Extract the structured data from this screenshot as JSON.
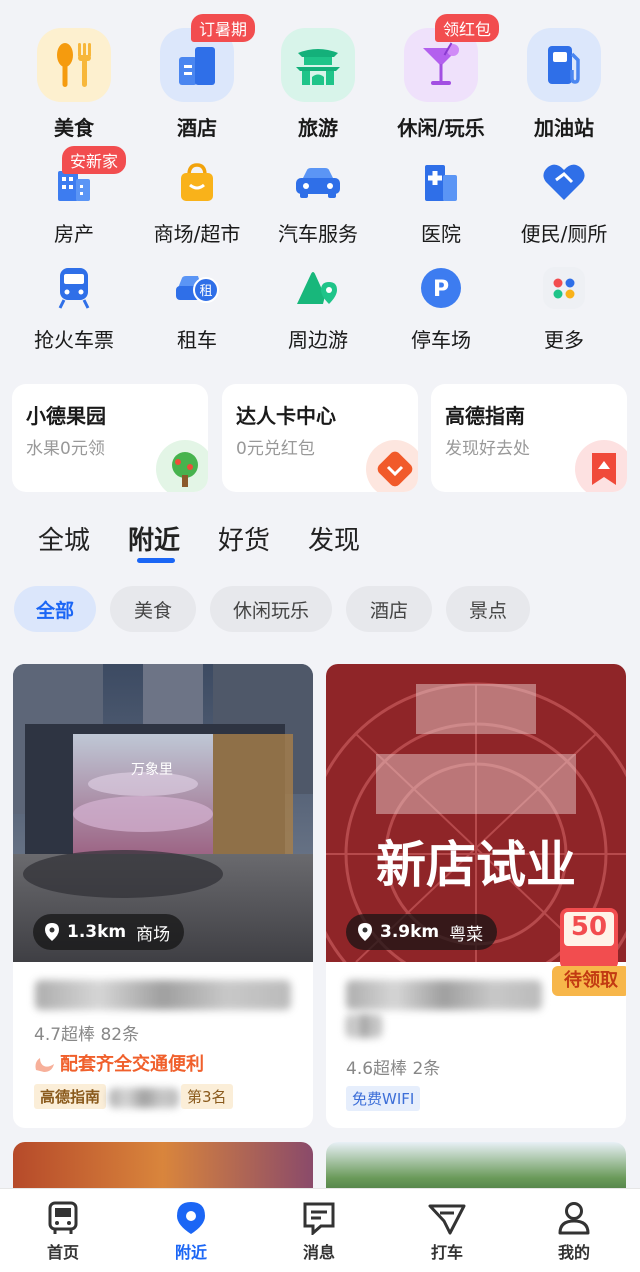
{
  "grid": [
    {
      "label": "美食",
      "icon": "food-icon",
      "badge": ""
    },
    {
      "label": "酒店",
      "icon": "hotel-icon",
      "badge": "订暑期"
    },
    {
      "label": "旅游",
      "icon": "travel-icon",
      "badge": ""
    },
    {
      "label": "休闲/玩乐",
      "icon": "leisure-icon",
      "badge": "领红包"
    },
    {
      "label": "加油站",
      "icon": "gas-station-icon",
      "badge": ""
    },
    {
      "label": "房产",
      "icon": "real-estate-icon",
      "badge": "安新家"
    },
    {
      "label": "商场/超市",
      "icon": "mall-icon",
      "badge": ""
    },
    {
      "label": "汽车服务",
      "icon": "car-service-icon",
      "badge": ""
    },
    {
      "label": "医院",
      "icon": "hospital-icon",
      "badge": ""
    },
    {
      "label": "便民/厕所",
      "icon": "convenience-icon",
      "badge": ""
    },
    {
      "label": "抢火车票",
      "icon": "train-ticket-icon",
      "badge": ""
    },
    {
      "label": "租车",
      "icon": "car-rental-icon",
      "badge": ""
    },
    {
      "label": "周边游",
      "icon": "nearby-tour-icon",
      "badge": ""
    },
    {
      "label": "停车场",
      "icon": "parking-icon",
      "badge": ""
    },
    {
      "label": "更多",
      "icon": "more-icon",
      "badge": ""
    }
  ],
  "promos": [
    {
      "title": "小德果园",
      "subtitle": "水果0元领"
    },
    {
      "title": "达人卡中心",
      "subtitle": "0元兑红包"
    },
    {
      "title": "高德指南",
      "subtitle": "发现好去处"
    }
  ],
  "tabs": [
    "全城",
    "附近",
    "好货",
    "发现"
  ],
  "active_tab": "附近",
  "filters": [
    "全部",
    "美食",
    "休闲玩乐",
    "酒店",
    "景点"
  ],
  "active_filter": "全部",
  "cards": [
    {
      "distance": "1.3km",
      "category": "商场",
      "image_sign": "万象里",
      "rating_text": "4.7超棒 82条",
      "highlight": "配套齐全交通便利",
      "guide_tag": "高德指南",
      "guide_rank": "第3名"
    },
    {
      "distance": "3.9km",
      "category": "粤菜",
      "image_headline": "新店试业",
      "coupon_value": "50",
      "coupon_label": "待领取",
      "rating_text": "4.6超棒 2条",
      "facility_tag": "免费WIFI"
    }
  ],
  "bottom_nav": [
    {
      "label": "首页",
      "icon": "bus-home-icon"
    },
    {
      "label": "附近",
      "icon": "location-pin-icon"
    },
    {
      "label": "消息",
      "icon": "message-icon"
    },
    {
      "label": "打车",
      "icon": "taxi-icon"
    },
    {
      "label": "我的",
      "icon": "user-icon"
    }
  ],
  "active_nav": "附近",
  "colors": {
    "accent": "#1b66f5",
    "badge": "#f24d4f",
    "highlight": "#f0602c",
    "background": "#f2f3f7"
  }
}
